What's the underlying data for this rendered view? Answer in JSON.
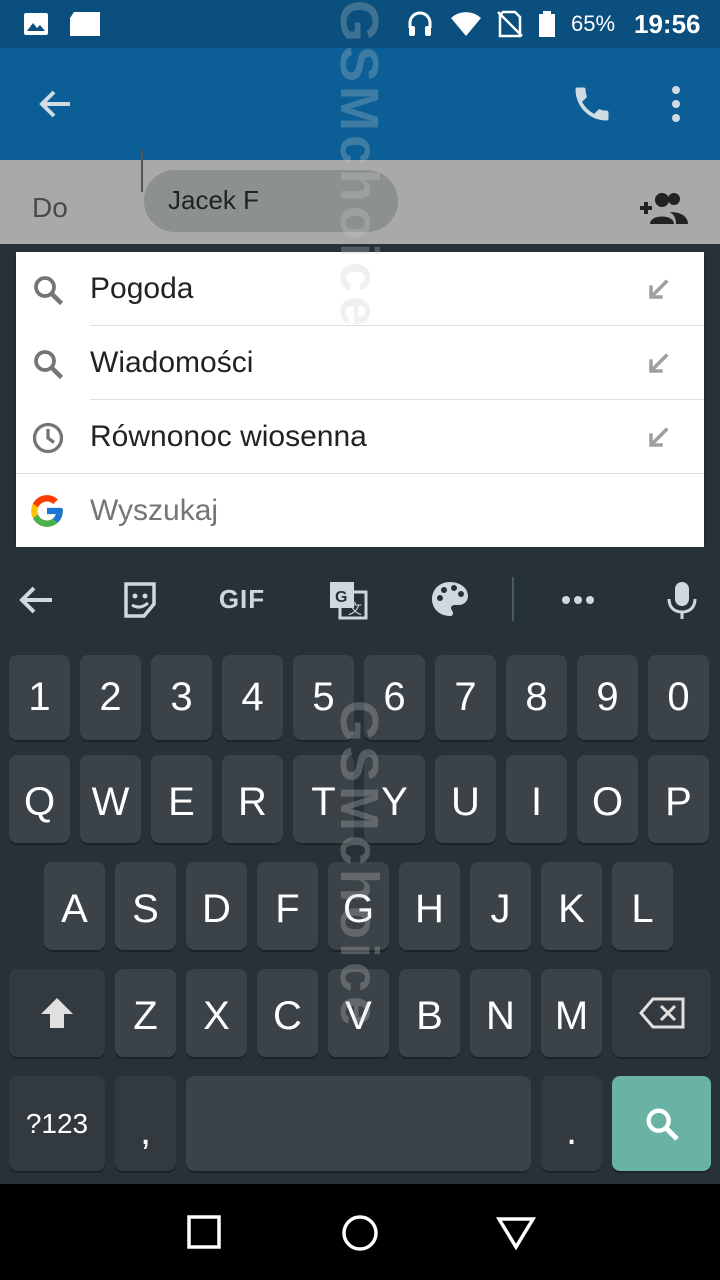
{
  "status_bar": {
    "battery_percent": "65%",
    "time": "19:56",
    "icons": [
      "gallery-icon",
      "sd-card-icon",
      "headset-icon",
      "wifi-icon",
      "no-sim-icon",
      "battery-icon"
    ]
  },
  "app_bar": {
    "back_icon": "arrow-back-icon",
    "call_icon": "phone-icon",
    "menu_icon": "more-vert-icon"
  },
  "recipient": {
    "label": "Do",
    "chip_text": "Jacek F",
    "add_contact_icon": "add-contacts-icon"
  },
  "suggestions": [
    {
      "text": "Pogoda",
      "icon": "search-icon",
      "action_icon": "insert-arrow-icon"
    },
    {
      "text": "Wiadomości",
      "icon": "search-icon",
      "action_icon": "insert-arrow-icon"
    },
    {
      "text": "Równonoc wiosenna",
      "icon": "history-icon",
      "action_icon": "insert-arrow-icon"
    }
  ],
  "search_row": {
    "placeholder": "Wyszukaj",
    "icon": "google-g-icon"
  },
  "keyboard_toolbar": {
    "gif_label": "GIF",
    "icons": [
      "back-arrow-icon",
      "sticker-icon",
      "gif-icon",
      "translate-icon",
      "palette-icon",
      "more-horiz-icon",
      "mic-icon"
    ]
  },
  "keyboard": {
    "row_numbers": [
      "1",
      "2",
      "3",
      "4",
      "5",
      "6",
      "7",
      "8",
      "9",
      "0"
    ],
    "row_q": [
      "Q",
      "W",
      "E",
      "R",
      "T",
      "Y",
      "U",
      "I",
      "O",
      "P"
    ],
    "row_a": [
      "A",
      "S",
      "D",
      "F",
      "G",
      "H",
      "J",
      "K",
      "L"
    ],
    "row_z": [
      "Z",
      "X",
      "C",
      "V",
      "B",
      "N",
      "M"
    ],
    "symbols_label": "?123",
    "comma": ",",
    "period": ".",
    "search_color": "#6ab2a3"
  },
  "nav_bar": {
    "icons": [
      "recents-square-icon",
      "home-circle-icon",
      "back-triangle-icon"
    ]
  },
  "watermark": {
    "text": "GSMchoice"
  }
}
